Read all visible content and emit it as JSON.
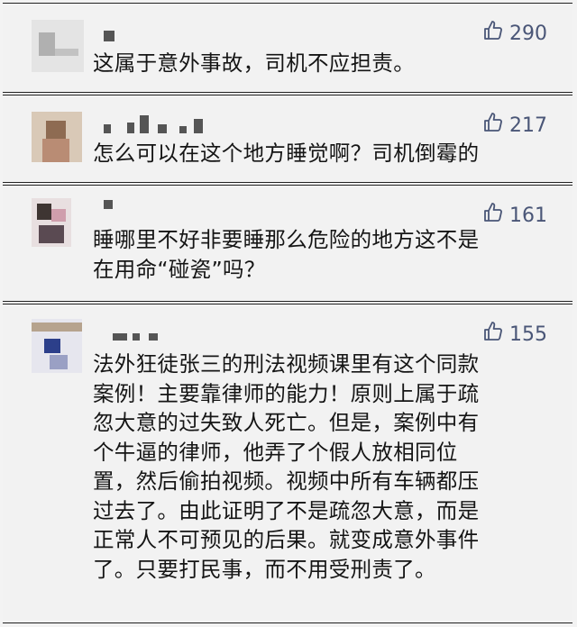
{
  "comments": [
    {
      "likes": "290",
      "text": "这属于意外事故，司机不应担责。"
    },
    {
      "likes": "217",
      "text": "怎么可以在这个地方睡觉啊？司机倒霉的"
    },
    {
      "likes": "161",
      "text": "睡哪里不好非要睡那么危险的地方这不是\n在用命“碰瓷”吗？"
    },
    {
      "likes": "155",
      "text": "法外狂徒张三的刑法视频课里有这个同款\n案例！主要靠律师的能力！原则上属于疏\n忽大意的过失致人死亡。但是，案例中有\n个牛逼的律师，他弄了个假人放相同位\n置，然后偷拍视频。视频中所有车辆都压\n过去了。由此证明了不是疏忽大意，而是\n正常人不可预见的后果。就变成意外事件\n了。只要打民事，而不用受刑责了。"
    }
  ],
  "like_icon": "thumbs-up-icon",
  "colors": {
    "like": "#4a5677",
    "text": "#151515",
    "background": "#f2f2f2"
  }
}
